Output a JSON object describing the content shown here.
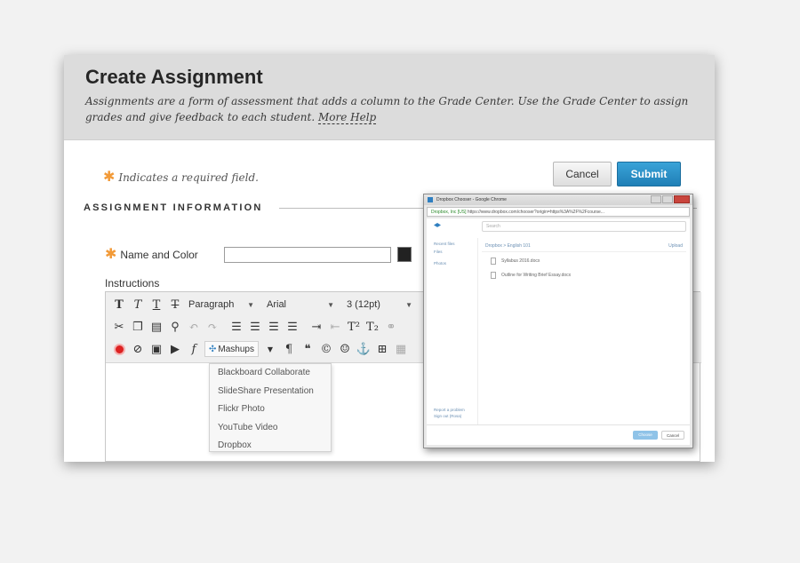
{
  "header": {
    "title": "Create Assignment",
    "subtitle": "Assignments are a form of assessment that adds a column to the Grade Center. Use the Grade Center to assign grades and give feedback to each student.",
    "more_help": "More Help"
  },
  "required_note": "Indicates a required field.",
  "buttons": {
    "cancel": "Cancel",
    "submit": "Submit"
  },
  "section_title": "ASSIGNMENT INFORMATION",
  "form": {
    "name_label": "Name and Color",
    "name_value": "",
    "color_swatch": "#222222",
    "instructions_label": "Instructions"
  },
  "toolbar": {
    "paragraph": "Paragraph",
    "font": "Arial",
    "size": "3 (12pt)",
    "mashups": "Mashups"
  },
  "mashups_menu": [
    "Blackboard Collaborate",
    "SlideShare Presentation",
    "Flickr Photo",
    "YouTube Video",
    "Dropbox"
  ],
  "popup": {
    "window_title": "Dropbox Chooser - Google Chrome",
    "address_secure": "Dropbox, Inc [US]",
    "address_url": "https://www.dropbox.com/chooser?origin=https%3A%2F%2Fcourse...",
    "search_placeholder": "Search",
    "sidebar": [
      "Recent files",
      "Files",
      "Photos"
    ],
    "sidebar_bottom": [
      "Report a problem",
      "Sign out (Rosa)"
    ],
    "breadcrumb": "Dropbox  >  English 101",
    "upload": "Upload",
    "files": [
      "Syllabus 2016.docx",
      "Outline for Writing Brief Essay.docx"
    ],
    "choose_label": "Choose",
    "cancel_label": "Cancel"
  },
  "colors": {
    "accent_submit": "#2a8fc7",
    "required_star": "#f29a38",
    "header_bg": "#dcdcdc"
  }
}
